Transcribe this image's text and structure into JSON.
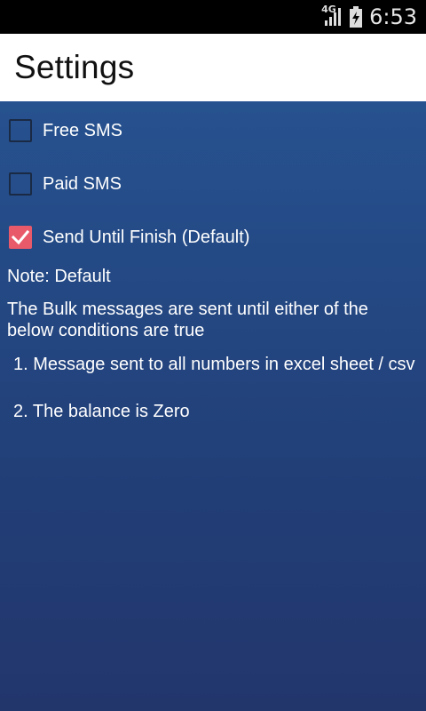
{
  "status_bar": {
    "network": "4G",
    "time": "6:53",
    "icons": [
      "signal-icon",
      "battery-charging-icon"
    ]
  },
  "header": {
    "title": "Settings"
  },
  "options": [
    {
      "label": "Free SMS",
      "checked": false
    },
    {
      "label": "Paid SMS",
      "checked": false
    },
    {
      "label": "Send Until Finish (Default)",
      "checked": true
    }
  ],
  "note": {
    "title": "Note: Default",
    "description": " The Bulk messages are sent until either of the below conditions are true",
    "conditions": [
      "1. Message sent to all numbers in excel sheet / csv",
      "2. The balance is Zero"
    ]
  },
  "colors": {
    "checkbox_checked": "#e85a6a",
    "background_top": "#26528f",
    "background_bottom": "#22366c"
  }
}
